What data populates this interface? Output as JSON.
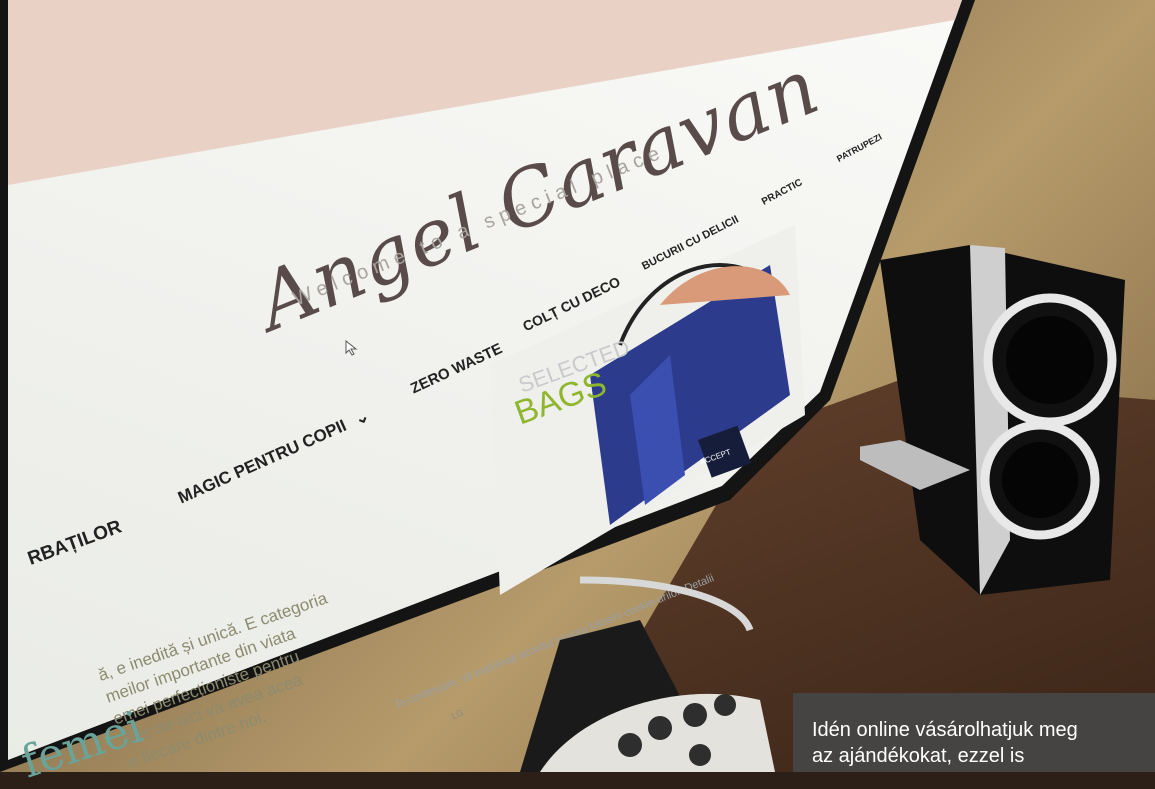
{
  "site": {
    "logo": "Angel Caravan",
    "tagline": "Welcome to a special place"
  },
  "nav": {
    "left_partial": "RBAȚILOR",
    "magic": "MAGIC PENTRU COPII",
    "magic_chevron": "chevron-down-icon",
    "zero_waste": "ZERO WASTE",
    "colt": "COLȚ CU DECO",
    "bucurii": "BUCURII CU DELICII",
    "practic": "PRACTIC",
    "patrupezi": "PATRUPEZI"
  },
  "content": {
    "heading": "femei",
    "lines": [
      "ă, e inedită și unică. E categoria",
      "meilor importante din viata",
      "emei perfecționiste pentru",
      "ales de aici va avea acea",
      "e fiecare dintre noi."
    ]
  },
  "banner": {
    "title_line1": "SELECTED",
    "title_line2": "BAGS",
    "button": "ACCEPT",
    "cookie_text": "În continuare, vă exprimați acordul asupra folosirii cookie-urilor. Detalii"
  },
  "monitor_brand": "LG",
  "caption": {
    "line1": "Idén online vásárolhatjuk meg",
    "line2": "az ajándékokat, ezzel is"
  },
  "colors": {
    "header_pink": "#e9d1c6",
    "heading_teal": "#6aa39a",
    "banner_blue": "#2c3b8c",
    "bags_green": "#8fb62f"
  }
}
